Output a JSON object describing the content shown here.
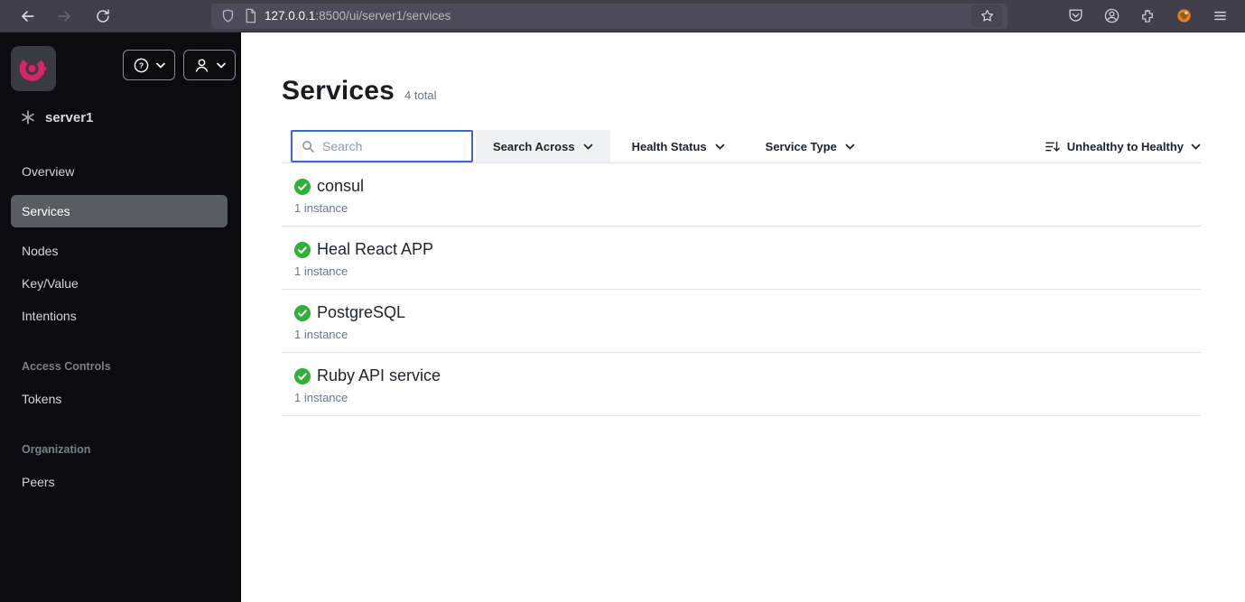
{
  "browser": {
    "url_host": "127.0.0.1",
    "url_path": ":8500/ui/server1/services"
  },
  "sidebar": {
    "datacenter": "server1",
    "nav": {
      "overview": "Overview",
      "services": "Services",
      "nodes": "Nodes",
      "keyvalue": "Key/Value",
      "intentions": "Intentions",
      "access_controls": "Access Controls",
      "tokens": "Tokens",
      "organization": "Organization",
      "peers": "Peers"
    }
  },
  "page": {
    "title": "Services",
    "total": "4 total"
  },
  "filters": {
    "search_placeholder": "Search",
    "search_across": "Search Across",
    "health_status": "Health Status",
    "service_type": "Service Type",
    "sort": "Unhealthy to Healthy"
  },
  "services": {
    "items": [
      {
        "name": "consul",
        "instances": "1 instance",
        "health": "passing"
      },
      {
        "name": "Heal React APP",
        "instances": "1 instance",
        "health": "passing"
      },
      {
        "name": "PostgreSQL",
        "instances": "1 instance",
        "health": "passing"
      },
      {
        "name": "Ruby API service",
        "instances": "1 instance",
        "health": "passing"
      }
    ]
  },
  "colors": {
    "brand_pink": "#db2468",
    "health_green": "#2eb039",
    "focus_blue": "#3b67d1"
  }
}
